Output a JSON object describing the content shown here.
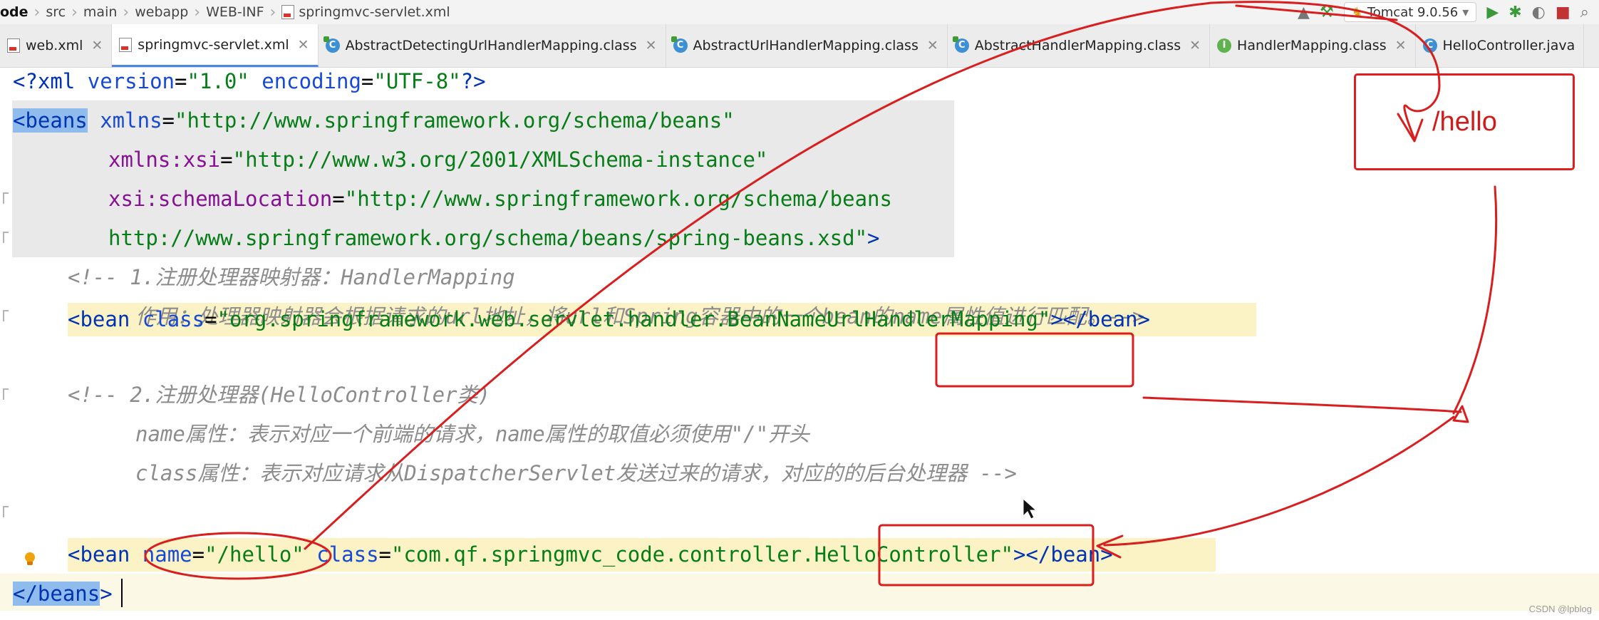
{
  "breadcrumb": [
    "ode",
    "src",
    "main",
    "webapp",
    "WEB-INF",
    "springmvc-servlet.xml"
  ],
  "run_config": {
    "label": "Tomcat 9.0.56"
  },
  "tabs": [
    {
      "label": "web.xml",
      "kind": "xml",
      "active": false
    },
    {
      "label": "springmvc-servlet.xml",
      "kind": "xml",
      "active": true
    },
    {
      "label": "AbstractDetectingUrlHandlerMapping.class",
      "kind": "abstract-class",
      "active": false
    },
    {
      "label": "AbstractUrlHandlerMapping.class",
      "kind": "abstract-class",
      "active": false
    },
    {
      "label": "AbstractHandlerMapping.class",
      "kind": "abstract-class",
      "active": false
    },
    {
      "label": "HandlerMapping.class",
      "kind": "interface",
      "active": false
    },
    {
      "label": "HelloController.java",
      "kind": "class",
      "active": false
    }
  ],
  "code": {
    "l1": {
      "a": "<?",
      "b": "xml",
      "c": " version",
      "d": "=",
      "e": "\"1.0\"",
      "f": " encoding",
      "g": "=",
      "h": "\"UTF-8\"",
      "i": "?>"
    },
    "l2": {
      "tag": "<beans",
      "attr": " xmlns",
      "eq": "=",
      "val": "\"http://www.springframework.org/schema/beans\""
    },
    "l3": {
      "ns": "xmlns:xsi",
      "eq": "=",
      "val": "\"http://www.w3.org/2001/XMLSchema-instance\""
    },
    "l4": {
      "ns": "xsi:schemaLocation",
      "eq": "=",
      "val": "\"http://www.springframework.org/schema/beans"
    },
    "l5": {
      "val": "http://www.springframework.org/schema/beans/spring-beans.xsd\"",
      "end": ">"
    },
    "l6": {
      "cmt": "<!-- 1.注册处理器映射器：HandlerMapping"
    },
    "l7": {
      "cmt": "作用：处理器映射器会根据请求的url地址，将url和Spring容器中的一个bean的name属性值进行匹配。-->"
    },
    "l8": {
      "tag": "<bean",
      "attr": " class",
      "eq": "=",
      "val": "\"org.springframework.web.servlet.handler.BeanNameUrlHandlerMapping\"",
      "end": "></bean>"
    },
    "l9": {
      "cmt": "<!-- 2.注册处理器(HelloController类)"
    },
    "l10": {
      "cmt": "name属性：表示对应一个前端的请求，name属性的取值必须使用\"/\"开头"
    },
    "l11": {
      "cmt": "class属性：表示对应请求从DispatcherServlet发送过来的请求，对应的的后台处理器 -->"
    },
    "l12": {
      "tag": "<bean",
      "attr1": " name",
      "eq1": "=",
      "val1": "\"/hello\"",
      "attr2": " class",
      "eq2": "=",
      "val2": "\"com.qf.springmvc_code.controller.HelloController\"",
      "end": "></bean>"
    },
    "l13": {
      "tag": "</beans",
      "end": ">"
    }
  },
  "annotation": {
    "callout_text": "/hello",
    "color": "#d11a1a"
  },
  "watermark": "CSDN @lpblog"
}
